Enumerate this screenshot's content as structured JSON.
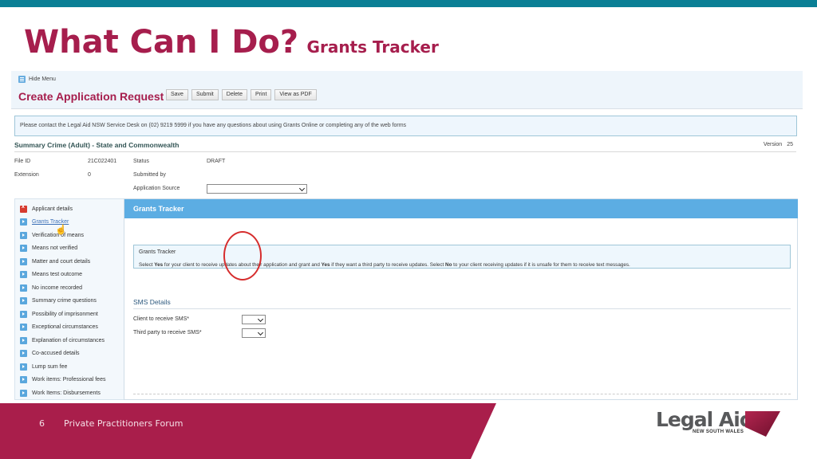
{
  "slide": {
    "title": "What Can I Do?",
    "subtitle": "Grants Tracker",
    "page_number": "6",
    "footer_text": "Private Practitioners Forum",
    "logo_text": "Legal Aid",
    "logo_subtext": "NEW SOUTH WALES",
    "colors": {
      "accent": "#a61e4d",
      "top_bar": "#0a7f95",
      "panel_header": "#5cade3"
    }
  },
  "app": {
    "hide_menu_label": "Hide Menu",
    "title": "Create Application Request",
    "toolbar": [
      "Save",
      "Submit",
      "Delete",
      "Print",
      "View as PDF"
    ],
    "notice": "Please contact the Legal Aid NSW Service Desk on (02) 9219 5999 if you have any questions about using Grants Online or completing any of the web forms",
    "form_title": "Summary Crime (Adult) - State and Commonwealth",
    "version_label": "Version",
    "version_value": "25",
    "meta": {
      "file_id_label": "File ID",
      "file_id_value": "21C022401",
      "extension_label": "Extension",
      "extension_value": "0",
      "status_label": "Status",
      "status_value": "DRAFT",
      "submitted_by_label": "Submitted by",
      "application_source_label": "Application Source",
      "application_source_value": ""
    },
    "sidebar": [
      {
        "label": "Applicant details",
        "icon": "error-x-icon"
      },
      {
        "label": "Grants Tracker",
        "icon": "arrow-icon",
        "active": true
      },
      {
        "label": "Verification of means",
        "icon": "arrow-icon"
      },
      {
        "label": "Means not verified",
        "icon": "arrow-icon"
      },
      {
        "label": "Matter and court details",
        "icon": "arrow-icon"
      },
      {
        "label": "Means test outcome",
        "icon": "arrow-icon"
      },
      {
        "label": "No income recorded",
        "icon": "arrow-icon"
      },
      {
        "label": "Summary crime questions",
        "icon": "arrow-icon"
      },
      {
        "label": "Possibility of imprisonment",
        "icon": "arrow-icon"
      },
      {
        "label": "Exceptional circumstances",
        "icon": "arrow-icon"
      },
      {
        "label": "Explanation of circumstances",
        "icon": "arrow-icon"
      },
      {
        "label": "Co-accused details",
        "icon": "arrow-icon"
      },
      {
        "label": "Lump sum fee",
        "icon": "arrow-icon"
      },
      {
        "label": "Work items: Professional fees",
        "icon": "arrow-icon"
      },
      {
        "label": "Work Items: Disbursements",
        "icon": "arrow-icon"
      }
    ],
    "panel": {
      "header": "Grants Tracker",
      "info_title": "Grants Tracker",
      "info_parts": [
        "Select ",
        "Yes",
        " for your client to receive updates about their application and grant and ",
        "Yes",
        " if they want a third party to receive updates. Select ",
        "No",
        " to your client receiving updates if it is unsafe for them to receive text messages."
      ],
      "sms_section_title": "SMS Details",
      "client_sms_label": "Client to receive SMS*",
      "client_sms_value": "",
      "third_party_sms_label": "Third party to receive SMS*",
      "third_party_sms_value": ""
    }
  }
}
